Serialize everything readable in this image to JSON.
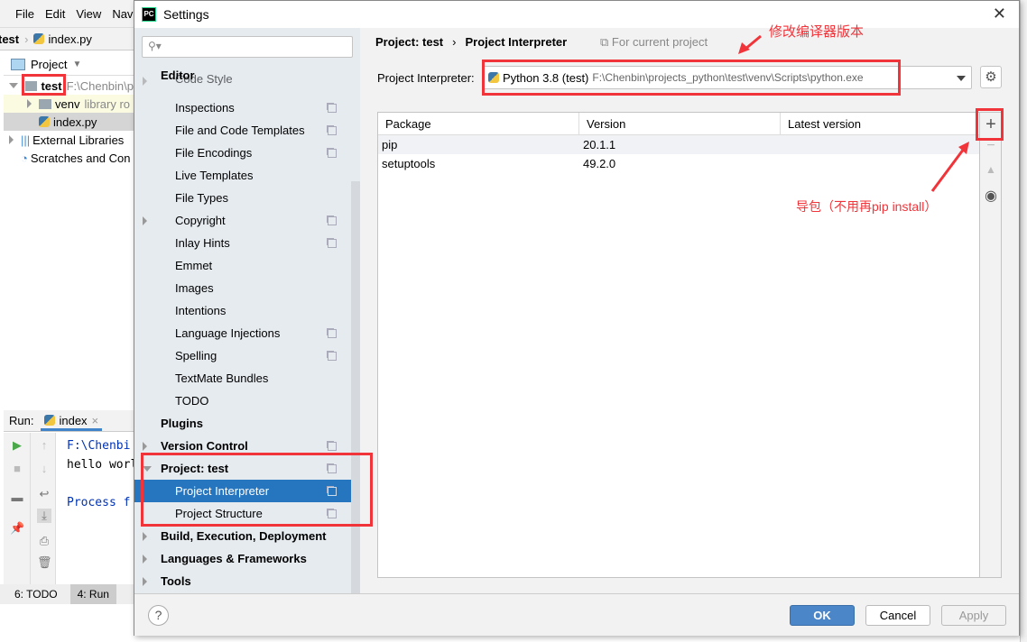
{
  "ide": {
    "menu": [
      "File",
      "Edit",
      "View",
      "Navi"
    ],
    "breadcrumb": {
      "project": "test",
      "file": "index.py"
    },
    "project_panel": {
      "title": "Project"
    },
    "tree": [
      {
        "label": "test",
        "hint": "F:\\Chenbin\\p",
        "type": "folder",
        "expanded": true
      },
      {
        "label": "venv",
        "hint": "library ro",
        "type": "folder",
        "expanded": false
      },
      {
        "label": "index.py",
        "hint": "",
        "type": "python"
      },
      {
        "label": "External Libraries",
        "hint": "",
        "type": "lib"
      },
      {
        "label": "Scratches and Con",
        "hint": "",
        "type": "scratch"
      }
    ],
    "run": {
      "label": "Run:",
      "tab": "index",
      "console": [
        "F:\\Chenbi",
        "hello worl",
        "",
        "Process f"
      ]
    },
    "bottom": {
      "todo": "6: TODO",
      "run": "4: Run"
    }
  },
  "dialog": {
    "title": "Settings",
    "search_placeholder": "",
    "nav": [
      {
        "label": "Editor",
        "level": 0,
        "bold": true
      },
      {
        "label": "Code Style",
        "level": 1,
        "arrow": "right",
        "copy": true,
        "partial": true
      },
      {
        "label": "Inspections",
        "level": 1,
        "copy": true
      },
      {
        "label": "File and Code Templates",
        "level": 1,
        "copy": true
      },
      {
        "label": "File Encodings",
        "level": 1,
        "copy": true
      },
      {
        "label": "Live Templates",
        "level": 1
      },
      {
        "label": "File Types",
        "level": 1
      },
      {
        "label": "Copyright",
        "level": 1,
        "arrow": "right",
        "copy": true
      },
      {
        "label": "Inlay Hints",
        "level": 1,
        "copy": true
      },
      {
        "label": "Emmet",
        "level": 1
      },
      {
        "label": "Images",
        "level": 1
      },
      {
        "label": "Intentions",
        "level": 1
      },
      {
        "label": "Language Injections",
        "level": 1,
        "copy": true
      },
      {
        "label": "Spelling",
        "level": 1,
        "copy": true
      },
      {
        "label": "TextMate Bundles",
        "level": 1
      },
      {
        "label": "TODO",
        "level": 1
      },
      {
        "label": "Plugins",
        "level": 0,
        "bold": true
      },
      {
        "label": "Version Control",
        "level": 0,
        "bold": true,
        "arrow": "right",
        "copy": true
      },
      {
        "label": "Project: test",
        "level": 0,
        "bold": true,
        "arrow": "down",
        "copy": true
      },
      {
        "label": "Project Interpreter",
        "level": 1,
        "copy": true,
        "selected": true
      },
      {
        "label": "Project Structure",
        "level": 1,
        "copy": true
      },
      {
        "label": "Build, Execution, Deployment",
        "level": 0,
        "bold": true,
        "arrow": "right"
      },
      {
        "label": "Languages & Frameworks",
        "level": 0,
        "bold": true,
        "arrow": "right"
      },
      {
        "label": "Tools",
        "level": 0,
        "bold": true,
        "arrow": "right"
      }
    ],
    "breadcrumb": [
      "Project: test",
      "Project Interpreter"
    ],
    "for_current_project": "For current project",
    "interpreter_label": "Project Interpreter:",
    "interpreter_name": "Python 3.8 (test)",
    "interpreter_path": "F:\\Chenbin\\projects_python\\test\\venv\\Scripts\\python.exe",
    "table": {
      "columns": [
        "Package",
        "Version",
        "Latest version"
      ],
      "rows": [
        [
          "pip",
          "20.1.1",
          ""
        ],
        [
          "setuptools",
          "49.2.0",
          ""
        ]
      ]
    },
    "buttons": {
      "ok": "OK",
      "cancel": "Cancel",
      "apply": "Apply",
      "help": "?"
    }
  },
  "annotations": {
    "interpreter": "修改编译器版本",
    "install": "导包（不用再pip install）",
    "color": "#f0343a"
  }
}
